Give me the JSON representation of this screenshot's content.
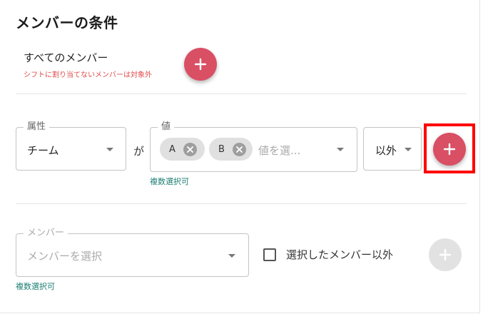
{
  "section": {
    "title": "メンバーの条件"
  },
  "all_members": {
    "label": "すべてのメンバー",
    "note": "シフトに割り当てないメンバーは対象外",
    "add_icon": "plus-icon"
  },
  "attribute_row": {
    "attribute_legend": "属性",
    "attribute_value": "チーム",
    "connector": "が",
    "value_legend": "値",
    "chips": [
      {
        "label": "A",
        "remove_icon": "close-circle-icon"
      },
      {
        "label": "B",
        "remove_icon": "close-circle-icon"
      }
    ],
    "value_placeholder": "値を選...",
    "value_hint": "複数選択可",
    "operator_value": "以外",
    "add_icon": "plus-icon"
  },
  "member_row": {
    "member_legend": "メンバー",
    "member_placeholder": "メンバーを選択",
    "member_hint": "複数選択可",
    "exclude_label": "選択したメンバー以外",
    "exclude_checked": false,
    "add_icon": "plus-icon"
  },
  "colors": {
    "accent_red": "#d94f64",
    "note_red": "#e14b4b",
    "hint_teal": "#1e7f74",
    "highlight_red": "#ff0000",
    "disabled_gray": "#e2e2e2"
  }
}
